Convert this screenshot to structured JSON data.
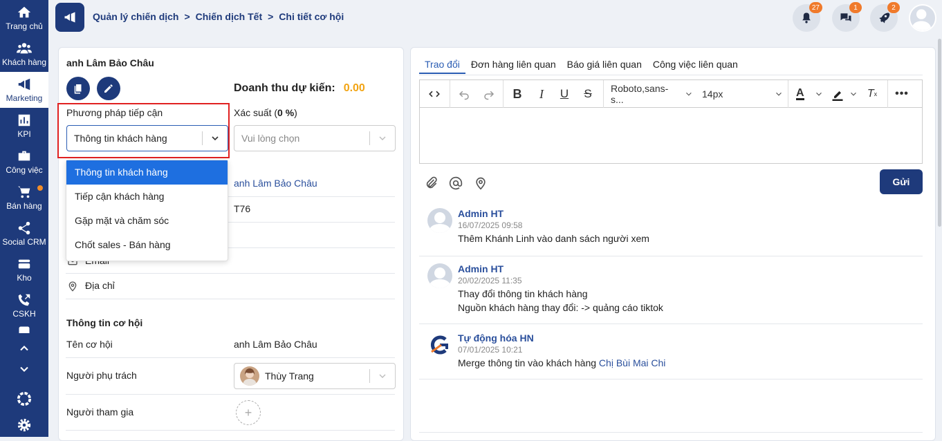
{
  "sidebar": {
    "items": [
      {
        "label": "Trang chủ",
        "icon": "home-icon"
      },
      {
        "label": "Khách hàng",
        "icon": "users-icon"
      },
      {
        "label": "Marketing",
        "icon": "megaphone-icon"
      },
      {
        "label": "KPI",
        "icon": "chart-icon"
      },
      {
        "label": "Công việc",
        "icon": "briefcase-icon"
      },
      {
        "label": "Bán hàng",
        "icon": "cart-icon"
      },
      {
        "label": "Social CRM",
        "icon": "share-icon"
      },
      {
        "label": "Kho",
        "icon": "warehouse-icon"
      },
      {
        "label": "CSKH",
        "icon": "phone-icon"
      }
    ]
  },
  "breadcrumb": {
    "items": [
      "Quản lý chiến dịch",
      "Chiến dịch Tết",
      "Chi tiết cơ hội"
    ],
    "separator": ">"
  },
  "header": {
    "notifications_count": "27",
    "messages_count": "1",
    "rocket_count": "2"
  },
  "left": {
    "customer_name": "anh Lâm Bảo Châu",
    "revenue_label": "Doanh thu dự kiến:",
    "revenue_value": "0.00",
    "approach_label": "Phương pháp tiếp cận",
    "approach_value": "Thông tin khách hàng",
    "probability_label_prefix": "Xác suất (",
    "probability_value": "0 %",
    "probability_label_suffix": ")",
    "probability_placeholder": "Vui lòng chọn",
    "approach_options": [
      "Thông tin khách hàng",
      "Tiếp cận khách hàng",
      "Gặp mặt và chăm sóc",
      "Chốt sales - Bán hàng"
    ],
    "contact_name_value": "anh Lâm Bảo Châu",
    "code_value": "T76",
    "email_label": "Email",
    "address_label": "Địa chỉ",
    "opportunity_section": "Thông tin cơ hội",
    "opportunity_name_label": "Tên cơ hội",
    "opportunity_name_value": "anh Lâm Bảo Châu",
    "owner_label": "Người phụ trách",
    "owner_value": "Thùy Trang",
    "participants_label": "Người tham gia"
  },
  "right": {
    "tabs": [
      "Trao đổi",
      "Đơn hàng liên quan",
      "Báo giá liên quan",
      "Công việc liên quan"
    ],
    "font_family": "Roboto,sans-s...",
    "font_size": "14px",
    "send_label": "Gửi",
    "activities": [
      {
        "name": "Admin HT",
        "time": "16/07/2025 09:58",
        "lines": [
          "Thêm Khánh Linh vào danh sách người xem"
        ]
      },
      {
        "name": "Admin HT",
        "time": "20/02/2025 11:35",
        "lines": [
          "Thay đổi thông tin khách hàng",
          "Nguồn khách hàng thay đổi: -> quảng cáo tiktok"
        ]
      },
      {
        "name": "Tự động hóa HN",
        "time": "07/01/2025 10:21",
        "line_prefix": "Merge thông tin vào khách hàng ",
        "link": "Chị Bùi Mai Chi"
      }
    ]
  },
  "colors": {
    "primary": "#1e3a7b",
    "accent": "#f2a413",
    "highlight": "#1e6fe0",
    "badge": "#f07a2b",
    "alert_box": "#e02020"
  }
}
